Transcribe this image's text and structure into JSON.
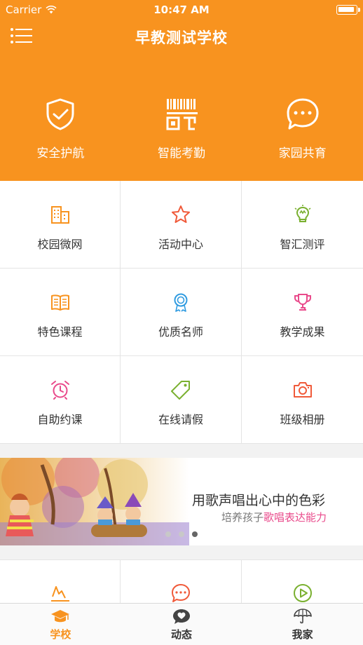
{
  "status": {
    "carrier": "Carrier",
    "time": "10:47 AM"
  },
  "header": {
    "title": "早教测试学校"
  },
  "features": [
    {
      "label": "安全护航",
      "icon": "shield-check-icon"
    },
    {
      "label": "智能考勤",
      "icon": "barcode-scan-icon"
    },
    {
      "label": "家园共育",
      "icon": "chat-bubble-icon"
    }
  ],
  "grid": [
    {
      "label": "校园微网",
      "icon": "building-icon",
      "color": "#f8931f"
    },
    {
      "label": "活动中心",
      "icon": "star-icon",
      "color": "#f05a3a"
    },
    {
      "label": "智汇测评",
      "icon": "lightbulb-icon",
      "color": "#7ab030"
    },
    {
      "label": "特色课程",
      "icon": "book-icon",
      "color": "#f8931f"
    },
    {
      "label": "优质名师",
      "icon": "award-ribbon-icon",
      "color": "#2f9be0"
    },
    {
      "label": "教学成果",
      "icon": "trophy-icon",
      "color": "#e94a8b"
    },
    {
      "label": "自助约课",
      "icon": "alarm-clock-icon",
      "color": "#e94a8b"
    },
    {
      "label": "在线请假",
      "icon": "tag-icon",
      "color": "#7ab030"
    },
    {
      "label": "班级相册",
      "icon": "camera-icon",
      "color": "#f05a3a"
    }
  ],
  "banner": {
    "title": "用歌声唱出心中的色彩",
    "subtitle_prefix": "培养孩子",
    "subtitle_highlight": "歌唱表达能力",
    "active_slide": 3,
    "slide_count": 3
  },
  "grid2": [
    {
      "icon": "chart-line-icon",
      "color": "#f8931f"
    },
    {
      "icon": "chat-dots-icon",
      "color": "#f05a3a"
    },
    {
      "icon": "play-circle-icon",
      "color": "#7ab030"
    }
  ],
  "tabs": [
    {
      "label": "学校",
      "icon": "graduation-cap-icon",
      "active": true
    },
    {
      "label": "动态",
      "icon": "heart-bubble-icon",
      "active": false
    },
    {
      "label": "我家",
      "icon": "umbrella-icon",
      "active": false
    }
  ],
  "colors": {
    "brand": "#f8931f"
  }
}
